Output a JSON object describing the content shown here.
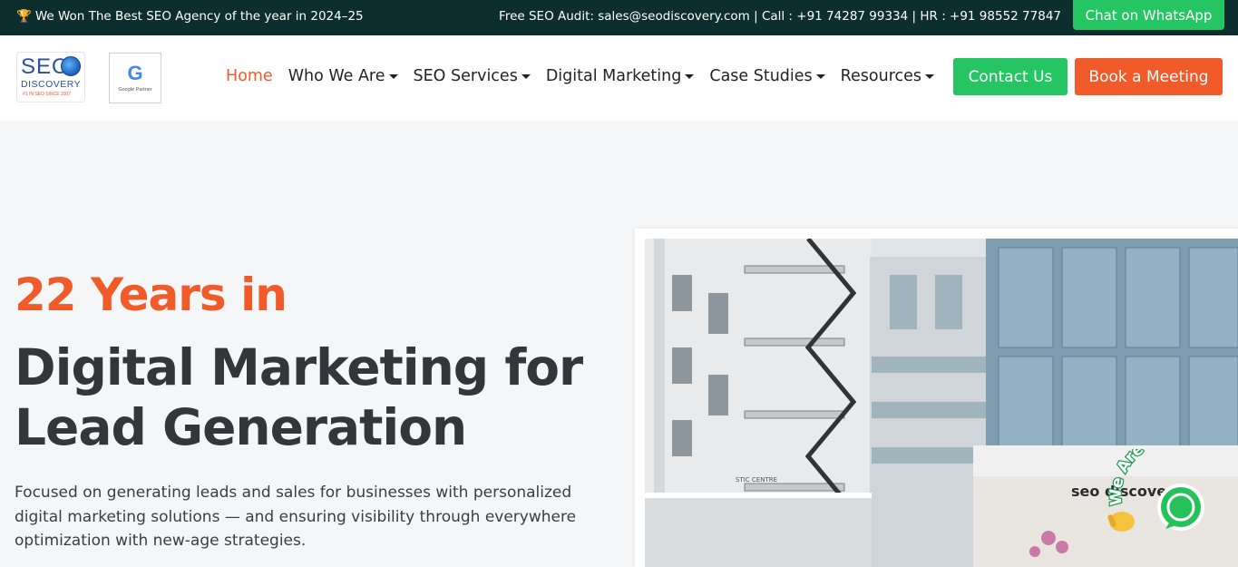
{
  "topbar": {
    "award": "We Won The Best SEO Agency of the year in 2024–25",
    "contact": "Free SEO Audit: sales@seodiscovery.com | Call : +91 74287 99334 | HR : +91 98552 77847",
    "whatsapp_label": "Chat on WhatsApp"
  },
  "header": {
    "logo": {
      "line1": "SEO",
      "line2": "DISCOVERY",
      "tagline": "#1 IN SEO SINCE 2007"
    },
    "partner": {
      "letter": "G",
      "label": "Google Partner"
    },
    "nav": [
      {
        "label": "Home",
        "active": true
      },
      {
        "label": "Who We Are"
      },
      {
        "label": "SEO Services"
      },
      {
        "label": "Digital Marketing"
      },
      {
        "label": "Case Studies"
      },
      {
        "label": "Resources"
      }
    ],
    "contact_label": "Contact Us",
    "meeting_label": "Book a Meeting"
  },
  "hero": {
    "pre_title": "22 Years in",
    "title": "Digital Marketing for Lead Generation",
    "description": "Focused on generating leads and sales for businesses with personalized digital marketing solutions — and ensuring visibility through everywhere optimization with new-age strategies."
  },
  "photo": {
    "sign_text": "seo discovery",
    "sign_small": "STIC CENTRE"
  },
  "floating": {
    "text": "We Are Here!"
  },
  "colors": {
    "topbar_bg": "#0d2e2f",
    "accent_orange": "#f15a29",
    "accent_green": "#26c564",
    "heading_dark": "#33363b"
  }
}
